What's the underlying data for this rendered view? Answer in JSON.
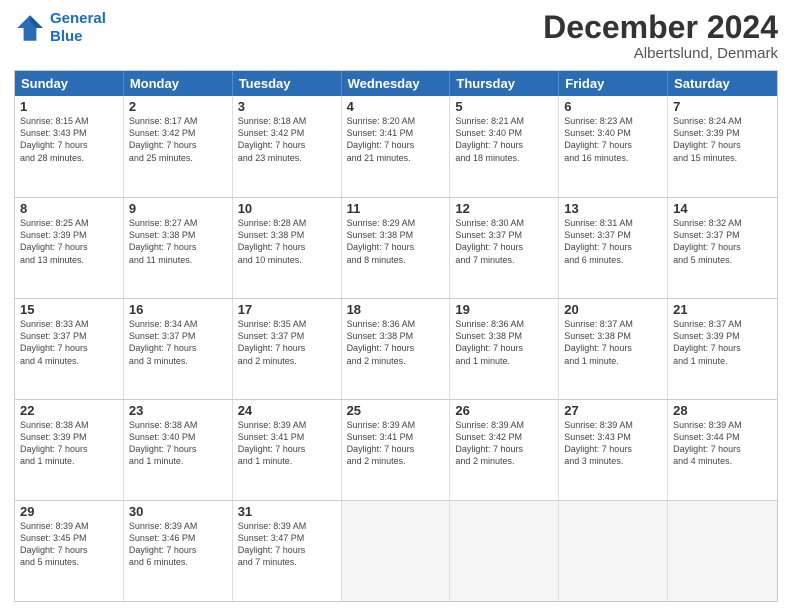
{
  "header": {
    "logo_line1": "General",
    "logo_line2": "Blue",
    "month": "December 2024",
    "location": "Albertslund, Denmark"
  },
  "weekdays": [
    "Sunday",
    "Monday",
    "Tuesday",
    "Wednesday",
    "Thursday",
    "Friday",
    "Saturday"
  ],
  "weeks": [
    [
      {
        "day": "1",
        "info": "Sunrise: 8:15 AM\nSunset: 3:43 PM\nDaylight: 7 hours\nand 28 minutes."
      },
      {
        "day": "2",
        "info": "Sunrise: 8:17 AM\nSunset: 3:42 PM\nDaylight: 7 hours\nand 25 minutes."
      },
      {
        "day": "3",
        "info": "Sunrise: 8:18 AM\nSunset: 3:42 PM\nDaylight: 7 hours\nand 23 minutes."
      },
      {
        "day": "4",
        "info": "Sunrise: 8:20 AM\nSunset: 3:41 PM\nDaylight: 7 hours\nand 21 minutes."
      },
      {
        "day": "5",
        "info": "Sunrise: 8:21 AM\nSunset: 3:40 PM\nDaylight: 7 hours\nand 18 minutes."
      },
      {
        "day": "6",
        "info": "Sunrise: 8:23 AM\nSunset: 3:40 PM\nDaylight: 7 hours\nand 16 minutes."
      },
      {
        "day": "7",
        "info": "Sunrise: 8:24 AM\nSunset: 3:39 PM\nDaylight: 7 hours\nand 15 minutes."
      }
    ],
    [
      {
        "day": "8",
        "info": "Sunrise: 8:25 AM\nSunset: 3:39 PM\nDaylight: 7 hours\nand 13 minutes."
      },
      {
        "day": "9",
        "info": "Sunrise: 8:27 AM\nSunset: 3:38 PM\nDaylight: 7 hours\nand 11 minutes."
      },
      {
        "day": "10",
        "info": "Sunrise: 8:28 AM\nSunset: 3:38 PM\nDaylight: 7 hours\nand 10 minutes."
      },
      {
        "day": "11",
        "info": "Sunrise: 8:29 AM\nSunset: 3:38 PM\nDaylight: 7 hours\nand 8 minutes."
      },
      {
        "day": "12",
        "info": "Sunrise: 8:30 AM\nSunset: 3:37 PM\nDaylight: 7 hours\nand 7 minutes."
      },
      {
        "day": "13",
        "info": "Sunrise: 8:31 AM\nSunset: 3:37 PM\nDaylight: 7 hours\nand 6 minutes."
      },
      {
        "day": "14",
        "info": "Sunrise: 8:32 AM\nSunset: 3:37 PM\nDaylight: 7 hours\nand 5 minutes."
      }
    ],
    [
      {
        "day": "15",
        "info": "Sunrise: 8:33 AM\nSunset: 3:37 PM\nDaylight: 7 hours\nand 4 minutes."
      },
      {
        "day": "16",
        "info": "Sunrise: 8:34 AM\nSunset: 3:37 PM\nDaylight: 7 hours\nand 3 minutes."
      },
      {
        "day": "17",
        "info": "Sunrise: 8:35 AM\nSunset: 3:37 PM\nDaylight: 7 hours\nand 2 minutes."
      },
      {
        "day": "18",
        "info": "Sunrise: 8:36 AM\nSunset: 3:38 PM\nDaylight: 7 hours\nand 2 minutes."
      },
      {
        "day": "19",
        "info": "Sunrise: 8:36 AM\nSunset: 3:38 PM\nDaylight: 7 hours\nand 1 minute."
      },
      {
        "day": "20",
        "info": "Sunrise: 8:37 AM\nSunset: 3:38 PM\nDaylight: 7 hours\nand 1 minute."
      },
      {
        "day": "21",
        "info": "Sunrise: 8:37 AM\nSunset: 3:39 PM\nDaylight: 7 hours\nand 1 minute."
      }
    ],
    [
      {
        "day": "22",
        "info": "Sunrise: 8:38 AM\nSunset: 3:39 PM\nDaylight: 7 hours\nand 1 minute."
      },
      {
        "day": "23",
        "info": "Sunrise: 8:38 AM\nSunset: 3:40 PM\nDaylight: 7 hours\nand 1 minute."
      },
      {
        "day": "24",
        "info": "Sunrise: 8:39 AM\nSunset: 3:41 PM\nDaylight: 7 hours\nand 1 minute."
      },
      {
        "day": "25",
        "info": "Sunrise: 8:39 AM\nSunset: 3:41 PM\nDaylight: 7 hours\nand 2 minutes."
      },
      {
        "day": "26",
        "info": "Sunrise: 8:39 AM\nSunset: 3:42 PM\nDaylight: 7 hours\nand 2 minutes."
      },
      {
        "day": "27",
        "info": "Sunrise: 8:39 AM\nSunset: 3:43 PM\nDaylight: 7 hours\nand 3 minutes."
      },
      {
        "day": "28",
        "info": "Sunrise: 8:39 AM\nSunset: 3:44 PM\nDaylight: 7 hours\nand 4 minutes."
      }
    ],
    [
      {
        "day": "29",
        "info": "Sunrise: 8:39 AM\nSunset: 3:45 PM\nDaylight: 7 hours\nand 5 minutes."
      },
      {
        "day": "30",
        "info": "Sunrise: 8:39 AM\nSunset: 3:46 PM\nDaylight: 7 hours\nand 6 minutes."
      },
      {
        "day": "31",
        "info": "Sunrise: 8:39 AM\nSunset: 3:47 PM\nDaylight: 7 hours\nand 7 minutes."
      },
      {
        "day": "",
        "info": ""
      },
      {
        "day": "",
        "info": ""
      },
      {
        "day": "",
        "info": ""
      },
      {
        "day": "",
        "info": ""
      }
    ]
  ]
}
